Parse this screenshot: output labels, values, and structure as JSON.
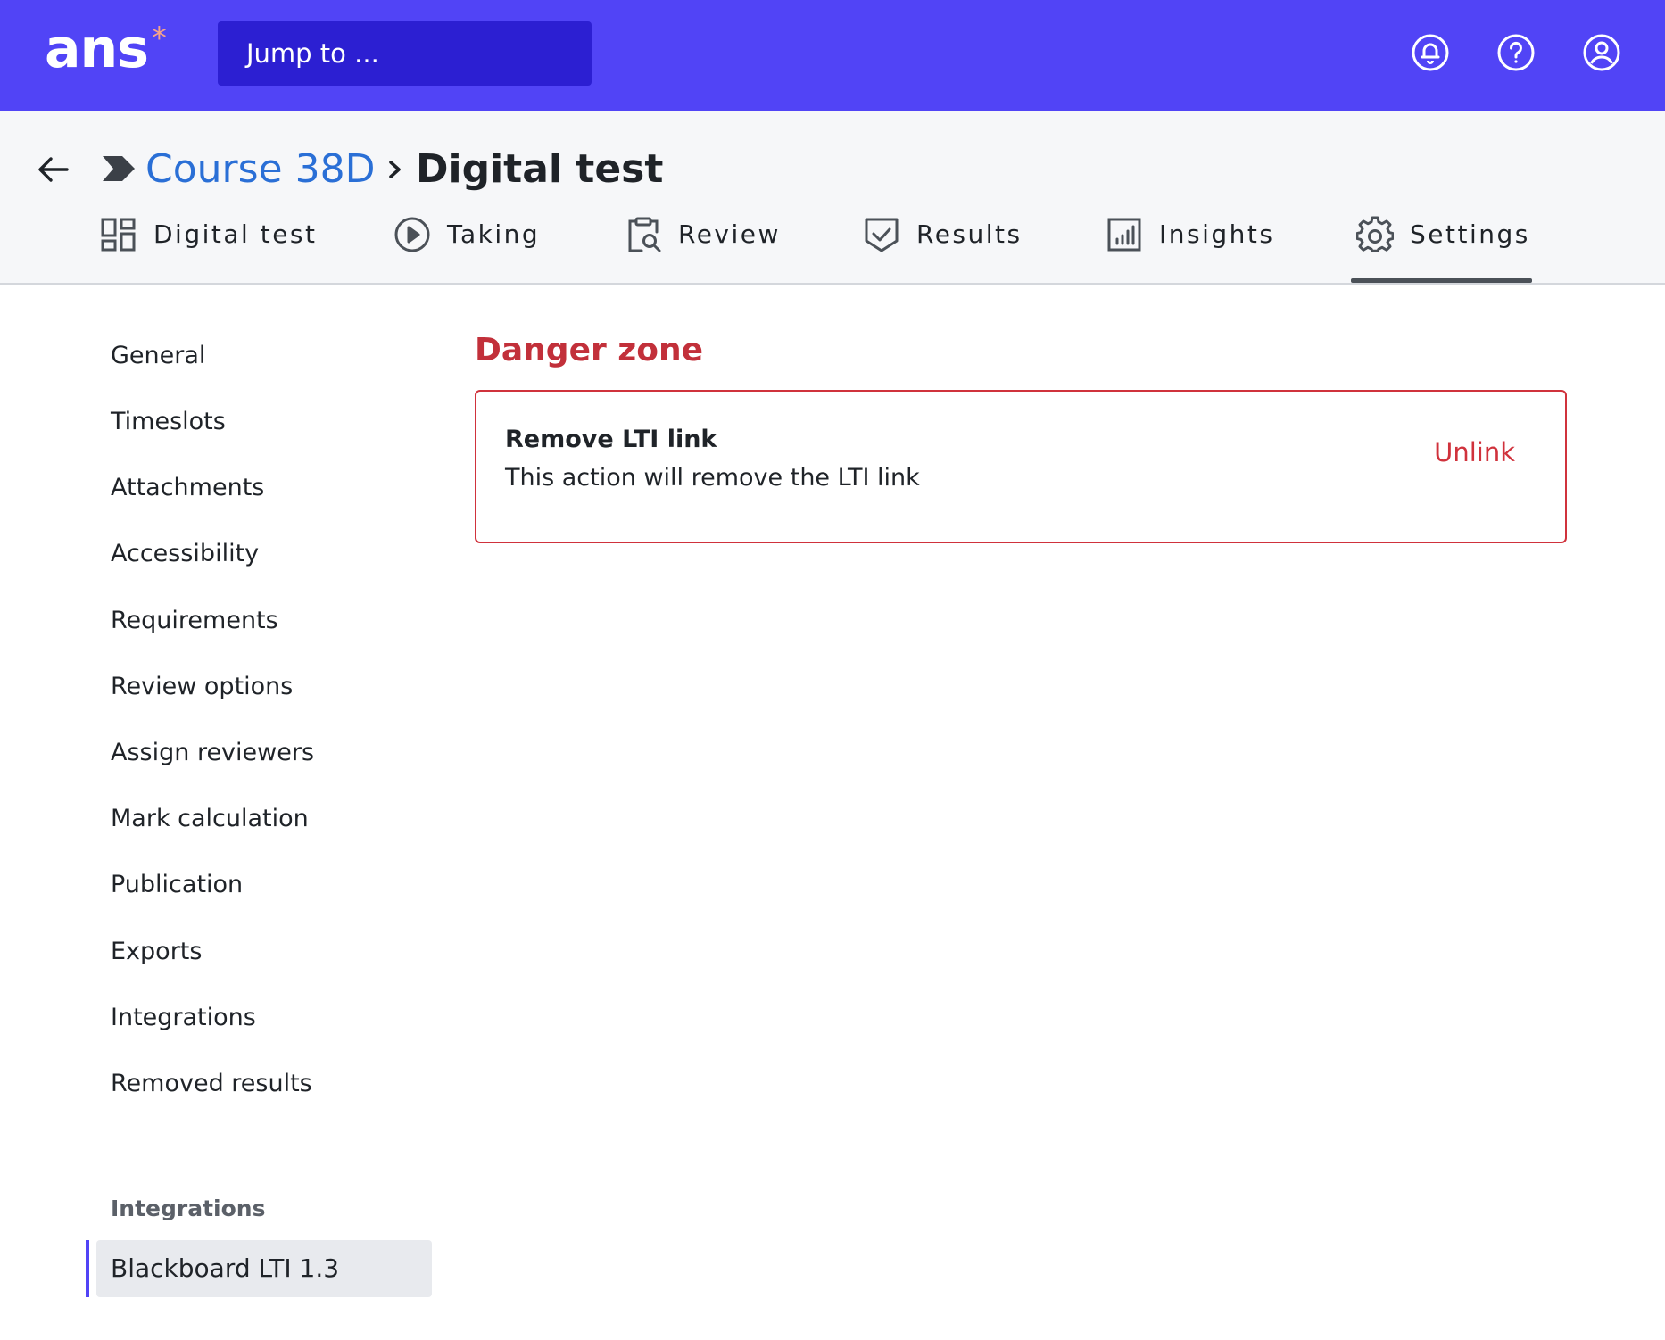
{
  "topbar": {
    "logo_text": "ans",
    "logo_mark": "*",
    "jump_placeholder": "Jump to ...",
    "icons": [
      "notifications-bell-icon",
      "help-question-icon",
      "user-account-icon"
    ],
    "colors": {
      "background": "#5144f6",
      "jump_background": "#2c1fd2",
      "logo_star": "#f5a38a"
    }
  },
  "breadcrumb": {
    "course": "Course 38D",
    "title": "Digital test"
  },
  "tabs": [
    {
      "label": "Digital test",
      "icon": "dashboard-grid-icon"
    },
    {
      "label": "Taking",
      "icon": "play-circle-icon"
    },
    {
      "label": "Review",
      "icon": "clipboard-search-icon"
    },
    {
      "label": "Results",
      "icon": "shield-check-icon"
    },
    {
      "label": "Insights",
      "icon": "bar-chart-icon"
    },
    {
      "label": "Settings",
      "icon": "gear-icon",
      "active": true
    }
  ],
  "sidebar": {
    "items": [
      "General",
      "Timeslots",
      "Attachments",
      "Accessibility",
      "Requirements",
      "Review options",
      "Assign reviewers",
      "Mark calculation",
      "Publication",
      "Exports",
      "Integrations",
      "Removed results"
    ],
    "section_heading": "Integrations",
    "active_item": "Blackboard LTI 1.3",
    "active_accent": "#5144f6"
  },
  "main": {
    "heading": "Danger zone",
    "card": {
      "title": "Remove LTI link",
      "description": "This action will remove the LTI link",
      "action_label": "Unlink"
    },
    "danger_color": "#d0323c"
  }
}
